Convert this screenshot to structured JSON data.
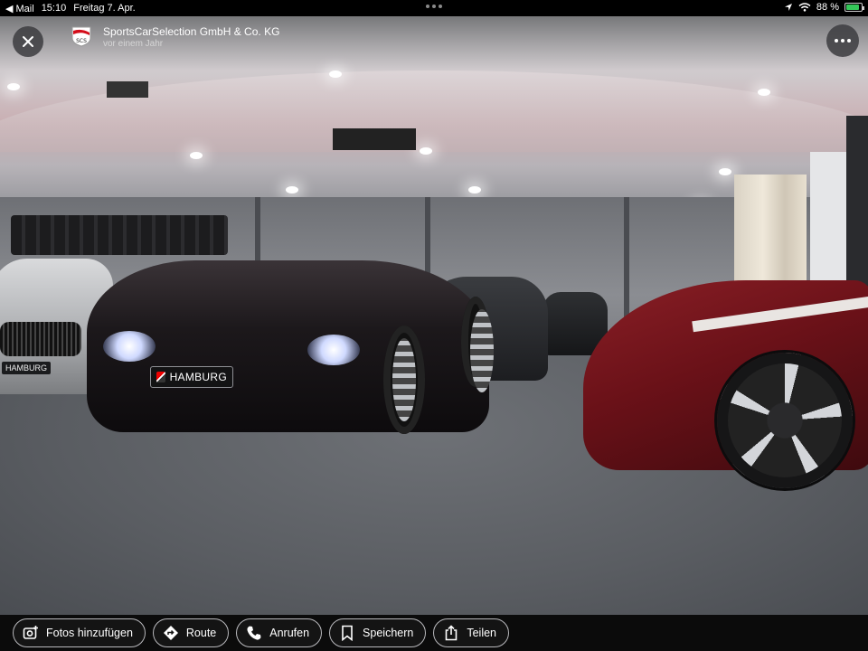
{
  "status_bar": {
    "back_app": "◀ Mail",
    "time": "15:10",
    "date": "Freitag 7. Apr.",
    "battery": "88 %",
    "battery_level": 0.88
  },
  "header": {
    "business_name": "SportsCarSelection GmbH & Co. KG",
    "posted": "vor einem Jahr",
    "logo_text": "SCS"
  },
  "photo": {
    "plate_main": "HAMBURG",
    "plate_left": "HAMBURG"
  },
  "actions": [
    {
      "label": "Fotos hinzufügen",
      "icon": "add-photo-icon"
    },
    {
      "label": "Route",
      "icon": "directions-icon"
    },
    {
      "label": "Anrufen",
      "icon": "phone-icon"
    },
    {
      "label": "Speichern",
      "icon": "bookmark-icon"
    },
    {
      "label": "Teilen",
      "icon": "share-icon"
    }
  ],
  "colors": {
    "background": "#000000",
    "accent_battery": "#35c759",
    "button_border": "#b9b9bd"
  }
}
